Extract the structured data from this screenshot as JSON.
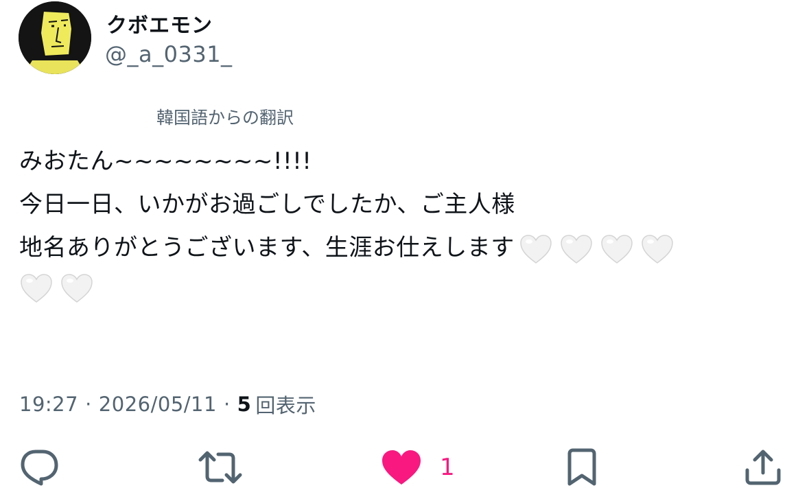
{
  "author": {
    "display_name": "クボエモン",
    "handle": "@_a_0331_",
    "avatar": "cartoon-face-avatar"
  },
  "translation_note": "韓国語からの翻訳",
  "tweet": {
    "line1": "みおたん~~~~~~~~!!!!",
    "line2": "今日一日、いかがお過ごしでしたか、ご主人様",
    "line3": "地名ありがとうございます、生涯お仕えします",
    "trailing_emoji": "white-heart",
    "trailing_emoji_count": 6
  },
  "meta": {
    "time": "19:27",
    "date": "2026/05/11",
    "separator": "·",
    "views_count": "5",
    "views_label": "回表示"
  },
  "actions": {
    "reply_icon": "speech-bubble-icon",
    "retweet_icon": "retweet-icon",
    "like_icon": "heart-filled-icon",
    "like_count": "1",
    "bookmark_icon": "bookmark-icon",
    "share_icon": "share-upload-icon"
  },
  "colors": {
    "text": "#0f1419",
    "secondary": "#536471",
    "like": "#f91880"
  }
}
